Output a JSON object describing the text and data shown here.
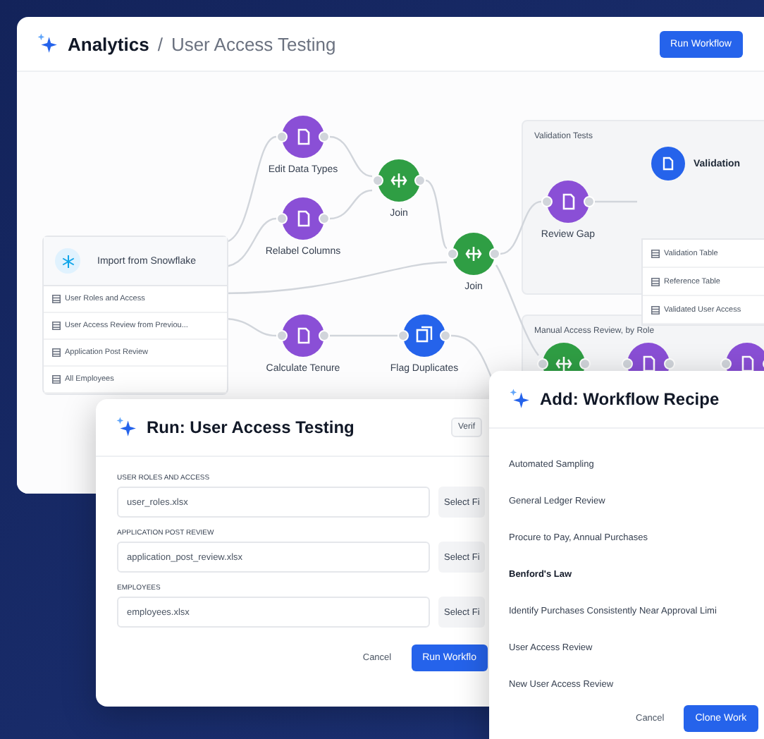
{
  "main_window": {
    "breadcrumb": [
      "Analytics",
      "User Access Testing"
    ],
    "separator": "/",
    "run_button": "Run Workflow",
    "canvas": {
      "source": {
        "title": "Import from Snowflake",
        "tables": [
          "User Roles and Access",
          "User Access Review from Previou...",
          "Application Post Review",
          "All Employees"
        ]
      },
      "nodes": [
        {
          "label": "Edit Data Types",
          "kind": "transform"
        },
        {
          "label": "Relabel Columns",
          "kind": "transform"
        },
        {
          "label": "Join",
          "kind": "join"
        },
        {
          "label": "Join",
          "kind": "join"
        },
        {
          "label": "Calculate Tenure",
          "kind": "transform"
        },
        {
          "label": "Flag Duplicates",
          "kind": "dedupe"
        },
        {
          "label": "Review Gap",
          "kind": "transform"
        }
      ],
      "groups": [
        {
          "title": "Validation Tests"
        },
        {
          "title": "Manual Access Review, by Role"
        }
      ],
      "validation": {
        "title": "Validation",
        "tables": [
          "Validation Table",
          "Reference Table",
          "Validated User Access"
        ]
      },
      "partial_nodes": [
        {
          "kind": "join"
        },
        {
          "kind": "transform"
        },
        {
          "kind": "transform"
        }
      ]
    }
  },
  "run_dialog": {
    "title": "Run: User Access Testing",
    "badge": "Verif",
    "fields": [
      {
        "label": "USER ROLES AND ACCESS",
        "value": "user_roles.xlsx",
        "button": "Select Fi"
      },
      {
        "label": "APPLICATION POST REVIEW",
        "value": "application_post_review.xlsx",
        "button": "Select Fi"
      },
      {
        "label": "EMPLOYEES",
        "value": "employees.xlsx",
        "button": "Select Fi"
      }
    ],
    "cancel": "Cancel",
    "primary": "Run Workflo"
  },
  "add_dialog": {
    "title": "Add: Workflow Recipe",
    "recipes": [
      {
        "label": "Automated Sampling",
        "selected": false
      },
      {
        "label": "General Ledger Review",
        "selected": false
      },
      {
        "label": "Procure to Pay, Annual Purchases",
        "selected": false
      },
      {
        "label": "Benford's Law",
        "selected": true
      },
      {
        "label": "Identify Purchases Consistently Near Approval Limi",
        "selected": false
      },
      {
        "label": "User Access Review",
        "selected": false
      },
      {
        "label": "New User Access Review",
        "selected": false
      }
    ],
    "cancel": "Cancel",
    "primary": "Clone Work"
  }
}
